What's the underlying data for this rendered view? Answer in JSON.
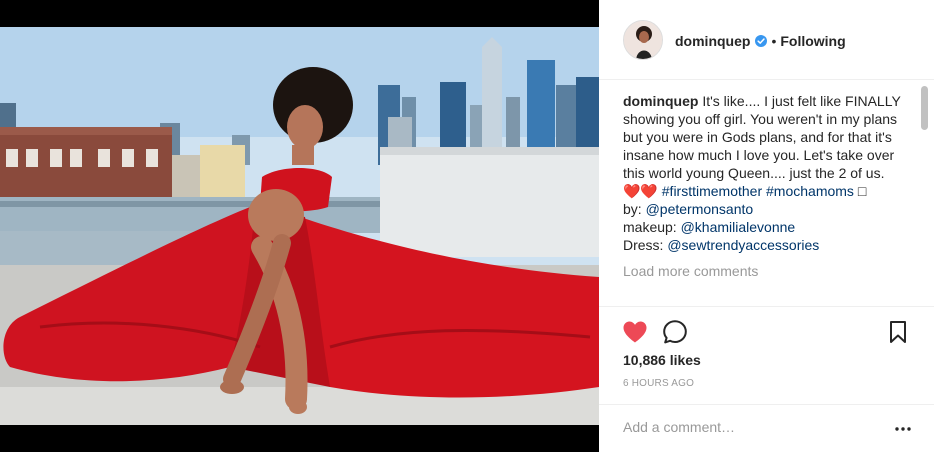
{
  "post": {
    "username": "dominquep",
    "verified": true,
    "separator": "•",
    "follow_status": "Following"
  },
  "caption": {
    "username": "dominquep",
    "text": "It's like.... I just felt like FINALLY showing you off girl. You weren't in my plans but you were in Gods plans, and for that it's insane how much I love you. Let's take over this world young Queen.... just the 2 of us.",
    "emoji": "❤️❤️",
    "hashtags": [
      "#firsttimemother",
      "#mochamoms"
    ],
    "box_glyph": "□",
    "credits": [
      {
        "label": "by:",
        "handle": "@petermonsanto"
      },
      {
        "label": "makeup:",
        "handle": "@khamilialevonne"
      },
      {
        "label": "Dress:",
        "handle": "@sewtrendyaccessories"
      }
    ]
  },
  "comments": {
    "load_more": "Load more comments"
  },
  "actions": {
    "like_icon": "heart-filled-icon",
    "comment_icon": "comment-icon",
    "save_icon": "bookmark-icon",
    "like_color": "#ed4956",
    "likes": "10,886 likes",
    "timestamp": "6 HOURS AGO"
  },
  "comment_box": {
    "placeholder": "Add a comment…",
    "more_icon": "more-options-icon"
  },
  "colors": {
    "link": "#003569",
    "muted": "#999999",
    "verified": "#3897f0",
    "gown": "#d4141f"
  }
}
